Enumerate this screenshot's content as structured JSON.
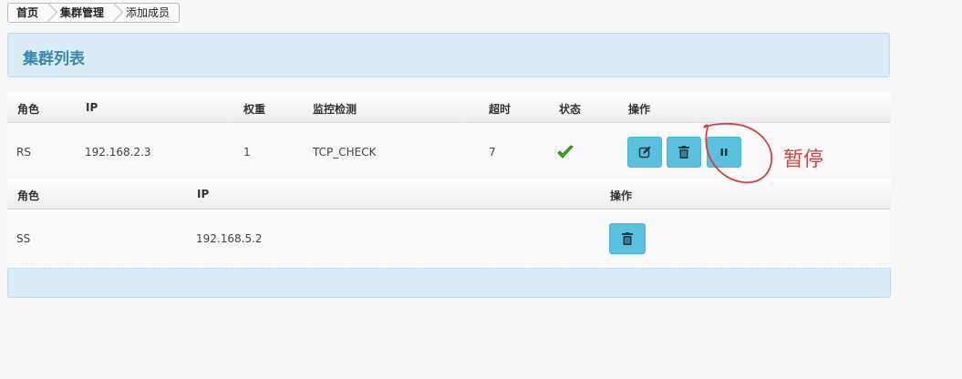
{
  "breadcrumb": {
    "items": [
      "首页",
      "集群管理",
      "添加成员"
    ]
  },
  "panel": {
    "title": "集群列表"
  },
  "rs_table": {
    "headers": [
      "角色",
      "IP",
      "权重",
      "监控检测",
      "超时",
      "状态",
      "操作"
    ],
    "row": {
      "role": "RS",
      "ip": "192.168.2.3",
      "weight": "1",
      "check": "TCP_CHECK",
      "timeout": "7",
      "status_icon": "check-icon"
    },
    "actions": [
      "edit-icon",
      "trash-icon",
      "pause-icon"
    ]
  },
  "ss_table": {
    "headers": [
      "角色",
      "IP",
      "操作"
    ],
    "row": {
      "role": "SS",
      "ip": "192.168.5.2"
    },
    "actions": [
      "trash-icon"
    ]
  },
  "annotation": {
    "text": "暂停",
    "color": "#d64040"
  },
  "colors": {
    "accent": "#3a87ad",
    "panel_bg": "#d9ecf5",
    "button": "#5bc0de",
    "status_ok": "#2e9d1a"
  }
}
